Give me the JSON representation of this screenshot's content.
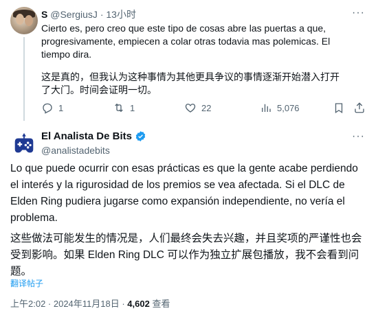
{
  "reply": {
    "display_name": "S",
    "handle": "@SergiusJ",
    "separator": "·",
    "time": "13小时",
    "more": "···",
    "text_es": "Cierto es, pero creo que este tipo de cosas abre las puertas a que, progresivamente, empiecen a colar otras todavia mas polemicas. El tiempo dira.",
    "text_zh": "这是真的，但我认为这种事情为其他更具争议的事情逐渐开始潜入打开了大门。时间会证明一切。",
    "actions": {
      "replies": "1",
      "reposts": "1",
      "likes": "22",
      "views": "5,076"
    },
    "icons": [
      "reply-icon",
      "repost-icon",
      "like-icon",
      "views-icon",
      "bookmark-icon",
      "share-icon"
    ]
  },
  "post": {
    "display_name": "El Analista De Bits",
    "handle": "@analistadebits",
    "more": "···",
    "text_es": "Lo que puede ocurrir con esas prácticas es que la gente acabe perdiendo el interés y la rigurosidad de los premios se vea afectada. Si el DLC de Elden Ring pudiera jugarse como expansión independiente, no vería el problema.",
    "text_zh": "这些做法可能发生的情况是，人们最终会失去兴趣，并且奖项的严谨性也会受到影响。如果 Elden Ring DLC 可以作为独立扩展包播放，我不会看到问题。",
    "translate_label": "翻译帖子",
    "timestamp": "上午2:02 · 2024年11月18日 · ",
    "views_count": "4,602",
    "views_label": " 查看"
  },
  "colors": {
    "text": "#0f1419",
    "secondary": "#536471",
    "link": "#1d9bf0",
    "verified": "#1d9bf0",
    "logo": "#1f3a93"
  }
}
